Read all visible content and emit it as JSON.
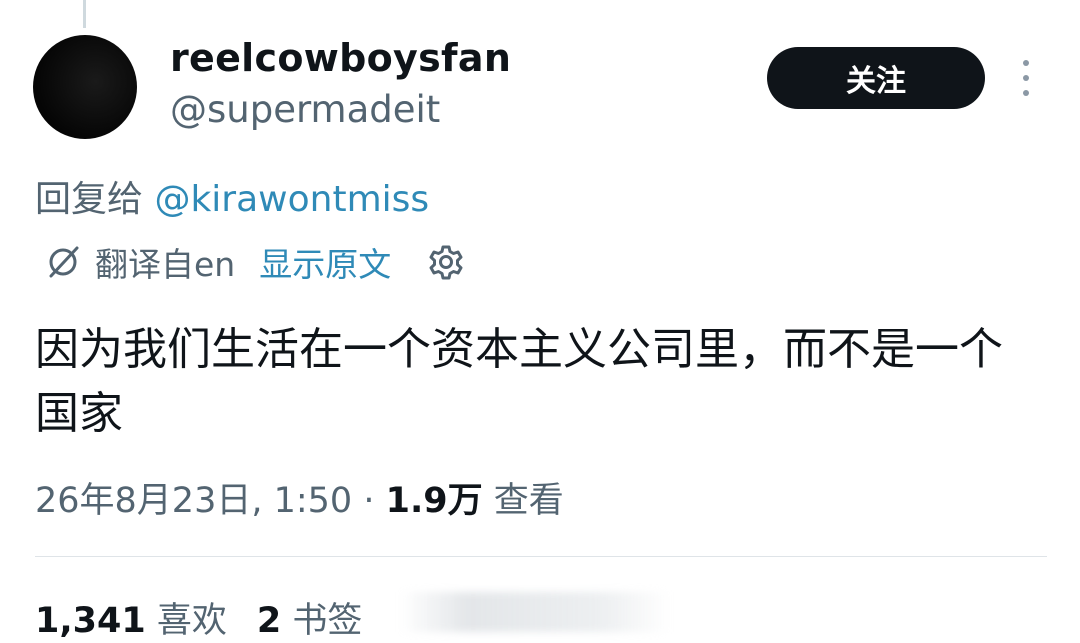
{
  "author": {
    "display_name": "reelcowboysfan",
    "handle": "@supermadeit"
  },
  "follow_button": {
    "label": "关注"
  },
  "more_icon": "more-vertical-icon",
  "reply": {
    "prefix": "回复给 ",
    "handle": "@kirawontmiss"
  },
  "translation": {
    "icon": "translate-icon",
    "label": "翻译自en",
    "show_original": "显示原文",
    "settings_icon": "gear-icon"
  },
  "tweet": {
    "text": "因为我们生活在一个资本主义公司里，而不是一个国家"
  },
  "meta": {
    "timestamp": "26年8月23日, 1:50",
    "separator": " · ",
    "views_count": "1.9万",
    "views_label": " 查看"
  },
  "stats": {
    "likes_count": "1,341",
    "likes_label": " 喜欢",
    "bookmarks_count": "2",
    "bookmarks_label": " 书签"
  },
  "colors": {
    "text_primary": "#0f1419",
    "text_secondary": "#536471",
    "link": "#2f8ab7",
    "button_bg": "#0f1419"
  }
}
